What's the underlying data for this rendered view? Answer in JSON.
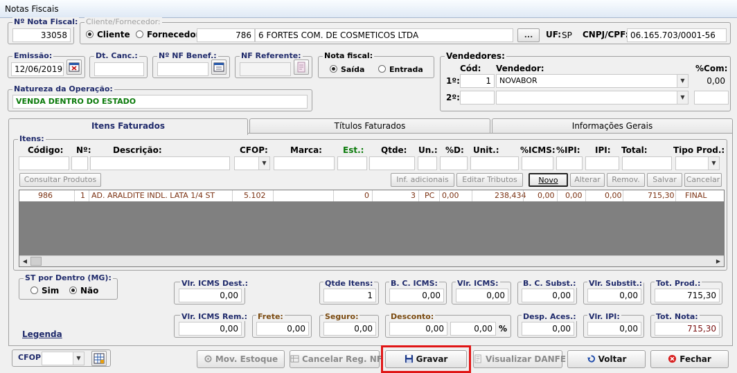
{
  "window": {
    "title": "Notas Fiscais"
  },
  "nota_fiscal": {
    "label": "Nº Nota Fiscal:",
    "value": "33058"
  },
  "cliente_fornecedor": {
    "label": "Cliente/Fornecedor:",
    "opt_cliente": "Cliente",
    "opt_fornecedor": "Fornecedor",
    "code": "786",
    "name": "6 FORTES COM. DE COSMETICOS LTDA",
    "browse_label": "...",
    "uf_label": "UF:",
    "uf_value": "SP",
    "cnpj_label": "CNPJ/CPF:",
    "cnpj_value": "06.165.703/0001-56"
  },
  "emissao": {
    "label": "Emissão:",
    "value": "12/06/2019"
  },
  "dt_canc": {
    "label": "Dt. Canc.:",
    "value": ""
  },
  "nf_benef": {
    "label": "Nº NF Benef.:",
    "value": ""
  },
  "nf_referente": {
    "label": "NF Referente:",
    "value": ""
  },
  "nota_tipo": {
    "label": "Nota fiscal:",
    "opt_saida": "Saída",
    "opt_entrada": "Entrada"
  },
  "vendedores": {
    "label": "Vendedores:",
    "col_cod": "Cód:",
    "col_vendedor": "Vendedor:",
    "col_com": "%Com:",
    "row1_label": "1º:",
    "row1_cod": "1",
    "row1_name": "NOVABOR",
    "row1_com": "0,00",
    "row2_label": "2º:"
  },
  "natureza": {
    "label": "Natureza da Operação:",
    "value": "VENDA DENTRO DO ESTADO"
  },
  "tabs": {
    "itens": "Itens Faturados",
    "titulos": "Títulos Faturados",
    "info": "Informações Gerais"
  },
  "itens": {
    "label": "Itens:",
    "h_codigo": "Código:",
    "h_n": "Nº:",
    "h_desc": "Descrição:",
    "h_cfop": "CFOP:",
    "h_marca": "Marca:",
    "h_est": "Est.:",
    "h_qtde": "Qtde:",
    "h_un": "Un.:",
    "h_d": "%D:",
    "h_unit": "Unit.:",
    "h_icms": "%ICMS:",
    "h_ipi_pct": "%IPI:",
    "h_ipi": "IPI:",
    "h_total": "Total:",
    "h_tipo": "Tipo Prod.:"
  },
  "item_buttons": {
    "consultar": "Consultar Produtos",
    "inf": "Inf. adicionais",
    "editar": "Editar Tributos",
    "novo": "Novo",
    "alterar": "Alterar",
    "remov": "Remov.",
    "salvar": "Salvar",
    "cancelar": "Cancelar"
  },
  "rows": [
    {
      "codigo": "986",
      "n": "1",
      "desc": "AD. ARALDITE INDL. LATA 1/4 ST",
      "cfop": "5.102",
      "est": "0",
      "qtde": "3",
      "un": "PC",
      "d": "0,00",
      "unit": "238,434",
      "icms": "0,00",
      "ipi_pct": "0,00",
      "ipi": "0,00",
      "total": "715,30",
      "tipo": "FINAL"
    }
  ],
  "st_dentro": {
    "label": "ST por Dentro (MG):",
    "opt_sim": "Sim",
    "opt_nao": "Não"
  },
  "legenda": "Legenda",
  "totals": {
    "vlr_icms_dest": {
      "label": "Vlr. ICMS Dest.:",
      "value": "0,00"
    },
    "qtde_itens": {
      "label": "Qtde Itens:",
      "value": "1"
    },
    "bc_icms": {
      "label": "B. C. ICMS:",
      "value": "0,00"
    },
    "vlr_icms": {
      "label": "Vlr. ICMS:",
      "value": "0,00"
    },
    "bc_subst": {
      "label": "B. C. Subst.:",
      "value": "0,00"
    },
    "vlr_subst": {
      "label": "Vlr. Substit.:",
      "value": "0,00"
    },
    "tot_prod": {
      "label": "Tot. Prod.:",
      "value": "715,30"
    },
    "vlr_icms_rem": {
      "label": "Vlr. ICMS Rem.:",
      "value": "0,00"
    },
    "frete": {
      "label": "Frete:",
      "value": "0,00"
    },
    "seguro": {
      "label": "Seguro:",
      "value": "0,00"
    },
    "desconto": {
      "label": "Desconto:",
      "value": "0,00",
      "pct": "0,00",
      "pct_sign": "%"
    },
    "desp_aces": {
      "label": "Desp. Aces.:",
      "value": "0,00"
    },
    "vlr_ipi": {
      "label": "Vlr. IPI:",
      "value": "0,00"
    },
    "tot_nota": {
      "label": "Tot. Nota:",
      "value": "715,30"
    }
  },
  "footer": {
    "cfop_label": "CFOP:",
    "mov_estoque": "Mov. Estoque",
    "cancelar_reg": "Cancelar Reg. NF",
    "gravar": "Gravar",
    "visualizar": "Visualizar DANFE",
    "voltar": "Voltar",
    "fechar": "Fechar"
  },
  "colors": {
    "highlight": "#e01515",
    "label_blue": "#1f2a6b",
    "value_green": "#0a7a0a",
    "total_red": "#7a1010"
  }
}
